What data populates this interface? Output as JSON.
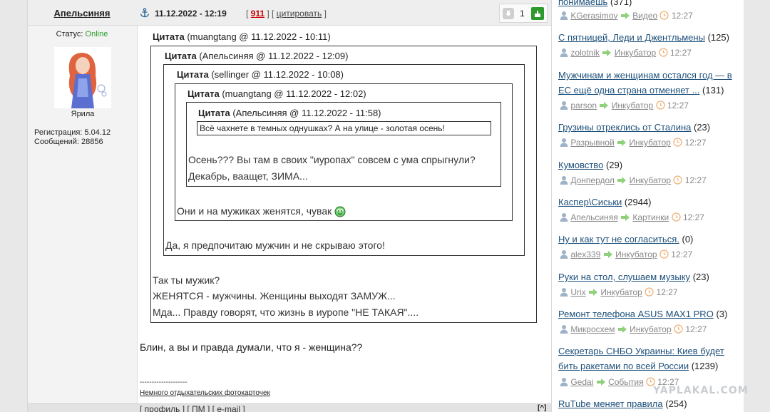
{
  "author": {
    "name": "Апельсиняя",
    "status_label": "Статус:",
    "status_value": "Online",
    "avatar_caption": "Ярила",
    "registration": "Регистрация: 5.04.12",
    "messages": "Сообщений: 28856"
  },
  "post": {
    "date": "11.12.2022 - 12:19",
    "number": "911",
    "quote_link": "цитировать",
    "rating_count": "1",
    "body": "Блин, а вы и правда думали, что я - женщина??",
    "sig_sep": "--------------------",
    "sig_link": "Немного отдыхательских фотокарточек",
    "footer": {
      "profile": "профиль",
      "pm": "ПМ",
      "email": "e-mail",
      "top": "[^]"
    }
  },
  "quotes": {
    "q1_head_word": "Цитата",
    "q1_head_info": "(muangtang @ 11.12.2022 - 10:11)",
    "q2_head_word": "Цитата",
    "q2_head_info": "(Апельсиняя @ 11.12.2022 - 12:09)",
    "q3_head_word": "Цитата",
    "q3_head_info": "(sellinger @ 11.12.2022 - 10:08)",
    "q4_head_word": "Цитата",
    "q4_head_info": "(muangtang @ 11.12.2022 - 12:02)",
    "q5_head_word": "Цитата",
    "q5_head_info": "(Апельсиняя @ 11.12.2022 - 11:58)",
    "q6_text": "Всё чахнете в темных однушках? А на улице - золотая осень!",
    "q5_lines": [
      "Осень??? Вы там в своих \"иуропах\" совсем с ума спрыгнули?",
      "Декабрь, ваащет, ЗИМА..."
    ],
    "q4_line": "Они и на мужиках женятся, чувак",
    "q3_line": "Да, я предпочитаю мужчин и не скрываю этого!",
    "q1_lines": [
      "Так ты мужик?",
      "ЖЕНЯТСЯ - мужчины. Женщины выходят ЗАМУЖ...",
      "Мда... Правду говорят, что жизнь в иуропе \"НЕ ТАКАЯ\"...."
    ]
  },
  "sidebar": {
    "topics": [
      {
        "title": "понимаешь",
        "count": "(371)",
        "user": "KGerasimov",
        "category": "Видео",
        "time": "12:27"
      },
      {
        "title": "С пятницей, Леди и Джентльмены",
        "count": "(125)",
        "user": "zolotnik",
        "category": "Инкубатор",
        "time": "12:27"
      },
      {
        "title": "Мужчинам и женщинам остался год — в ЕС ещё одна страна отменяет ...",
        "count": "(131)",
        "user": "parson",
        "category": "Инкубатор",
        "time": "12:27"
      },
      {
        "title": "Грузины отреклись от Сталина",
        "count": "(23)",
        "user": "Разрывной",
        "category": "Инкубатор",
        "time": "12:27"
      },
      {
        "title": "Кумовство",
        "count": "(29)",
        "user": "Донпердол",
        "category": "Инкубатор",
        "time": "12:27"
      },
      {
        "title": "Каспер\\Сиськи",
        "count": "(2944)",
        "user": "Апельсиняя",
        "category": "Картинки",
        "time": "12:27"
      },
      {
        "title": "Ну и как тут не согласиться.",
        "count": "(0)",
        "user": "alex339",
        "category": "Инкубатор",
        "time": "12:27"
      },
      {
        "title": "Руки на стол, слушаем музыку",
        "count": "(23)",
        "user": "Urix",
        "category": "Инкубатор",
        "time": "12:27"
      },
      {
        "title": "Ремонт телефона ASUS MAX1 PRO",
        "count": "(3)",
        "user": "Микросхем",
        "category": "Инкубатор",
        "time": "12:27"
      },
      {
        "title": "Секретарь СНБО Украины: Киев будет бить ракетами по всей России",
        "count": "(1239)",
        "user": "Gedai",
        "category": "События",
        "time": "12:27"
      },
      {
        "title": "RuTube меняет правила",
        "count": "(254)"
      }
    ]
  },
  "watermark": "YAPLAKAL.COM",
  "colors": {
    "online": "#2a9d2a",
    "post_number": "#cc0000",
    "rating_plus": "#2e9a2e",
    "topic_link": "#1c4f7a",
    "meta_gray": "#888888"
  }
}
